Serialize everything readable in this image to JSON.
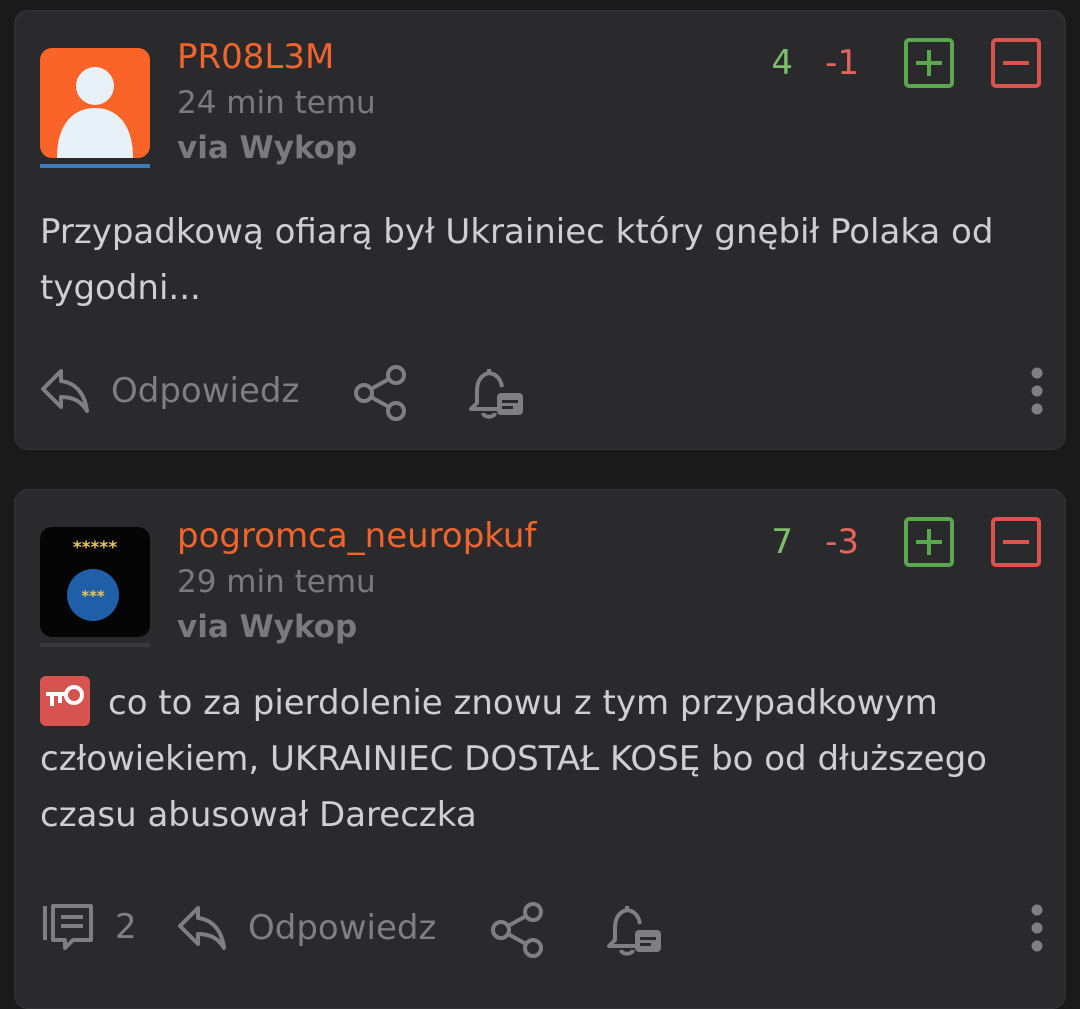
{
  "posts": [
    {
      "username": "PR08L3M",
      "time": "24 min temu",
      "via": "via Wykop",
      "votes_plus": "4",
      "votes_minus": "-1",
      "content": "Przypadkową ofiarą był Ukrainiec który gnębił Polaka od tygodni...",
      "reply_label": "Odpowiedz",
      "avatar_color": "#fa6428"
    },
    {
      "username": "pogromca_neuropkuf",
      "time": "29 min temu",
      "via": "via Wykop",
      "votes_plus": "7",
      "votes_minus": "-3",
      "content": "co to za pierdolenie znowu z tym przypadkowym człowiekiem, UKRAINIEC DOSTAŁ KOSĘ bo od dłuższego czasu abusował Dareczka",
      "reply_label": "Odpowiedz",
      "comment_count": "2",
      "avatar_stars_top": "*****",
      "avatar_stars_circle": "***"
    }
  ],
  "colors": {
    "username": "#f0642d",
    "plus": "#5aa84e",
    "minus": "#d9544e",
    "background": "#1a1a1b",
    "card": "#2a2a2c"
  },
  "icons": [
    "reply-icon",
    "share-icon",
    "notification-bell-icon",
    "more-options-icon",
    "comments-icon",
    "key-badge-icon",
    "plus-vote-icon",
    "minus-vote-icon"
  ]
}
